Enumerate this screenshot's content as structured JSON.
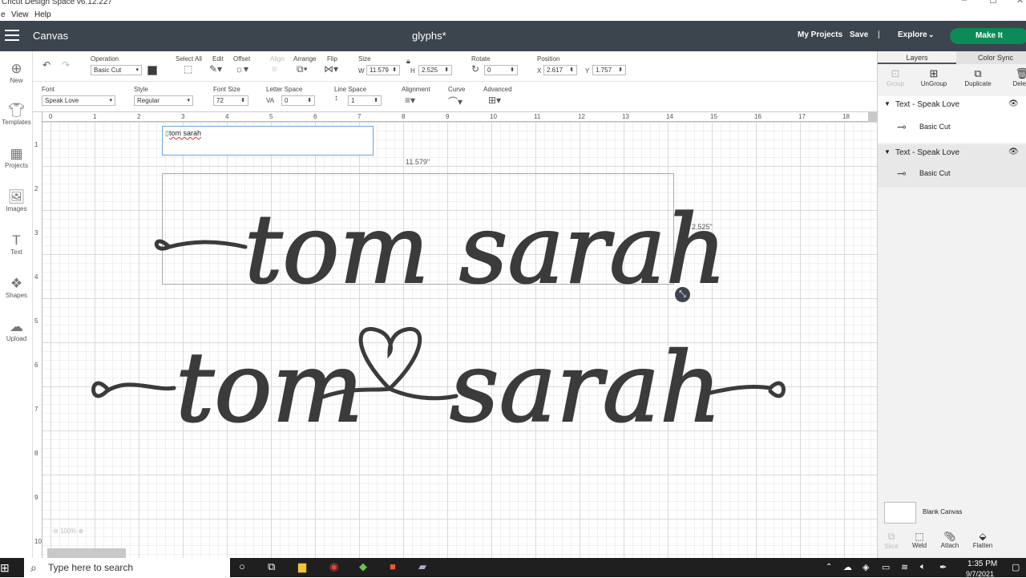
{
  "app": {
    "title": "Cricut Design Space  v6.12.227",
    "menus": [
      "e",
      "View",
      "Help"
    ]
  },
  "header": {
    "canvas_label": "Canvas",
    "project_name": "glyphs*",
    "my_projects": "My Projects",
    "save": "Save",
    "divider": "|",
    "explore": "Explore",
    "make_it": "Make It"
  },
  "toolbar": {
    "operation_label": "Operation",
    "operation_value": "Basic Cut",
    "select_all": "Select All",
    "edit": "Edit",
    "offset": "Offset",
    "align": "Align",
    "arrange": "Arrange",
    "flip": "Flip",
    "size_label": "Size",
    "w_label": "W",
    "w_value": "11.579",
    "h_label": "H",
    "h_value": "2.525",
    "rotate_label": "Rotate",
    "rotate_value": "0",
    "position_label": "Position",
    "x_label": "X",
    "x_value": "2.617",
    "y_label": "Y",
    "y_value": "1.757"
  },
  "text_toolbar": {
    "font_label": "Font",
    "font_value": "Speak Love",
    "style_label": "Style",
    "style_value": "Regular",
    "font_size_label": "Font Size",
    "font_size_value": "72",
    "letter_space_label": "Letter Space",
    "letter_space_icon": "VA",
    "letter_space_value": "0",
    "line_space_label": "Line Space",
    "line_space_value": "1",
    "alignment_label": "Alignment",
    "curve_label": "Curve",
    "advanced_label": "Advanced"
  },
  "sidebar": {
    "items": [
      {
        "label": "New",
        "icon": "plus-circle-icon"
      },
      {
        "label": "Templates",
        "icon": "tshirt-icon"
      },
      {
        "label": "Projects",
        "icon": "projects-icon"
      },
      {
        "label": "Images",
        "icon": "image-icon"
      },
      {
        "label": "Text",
        "icon": "text-icon"
      },
      {
        "label": "Shapes",
        "icon": "shapes-icon"
      },
      {
        "label": "Upload",
        "icon": "upload-cloud-icon"
      }
    ]
  },
  "canvas": {
    "edit_text": "tom sarah",
    "width_dim": "11.579\"",
    "height_dim": "2.525\"",
    "top_text": "tom sarah",
    "bottom_left": "tom",
    "bottom_right": "sarah",
    "zoom": "100%",
    "ruler_top": [
      "0",
      "1",
      "2",
      "3",
      "4",
      "5",
      "6",
      "7",
      "8",
      "9",
      "10",
      "11",
      "12",
      "13",
      "14",
      "15",
      "16",
      "17",
      "18"
    ],
    "ruler_left": [
      "1",
      "2",
      "3",
      "4",
      "5",
      "6",
      "7",
      "8",
      "9",
      "10"
    ]
  },
  "layers": {
    "tab_layers": "Layers",
    "tab_color_sync": "Color Sync",
    "actions": [
      "Group",
      "UnGroup",
      "Duplicate",
      "Delete"
    ],
    "items": [
      {
        "title": "Text - Speak Love",
        "sub": "Basic Cut"
      },
      {
        "title": "Text - Speak Love",
        "sub": "Basic Cut"
      }
    ],
    "blank_canvas": "Blank Canvas",
    "bottom_actions": [
      "Slice",
      "Weld",
      "Attach",
      "Flatten"
    ]
  },
  "taskbar": {
    "search_placeholder": "Type here to search",
    "time": "1:35 PM",
    "date": "9/7/2021"
  },
  "colors": {
    "header_bg": "#3c444d",
    "make_it": "#0c8a57",
    "glyph_fill": "#3b3b3b"
  }
}
